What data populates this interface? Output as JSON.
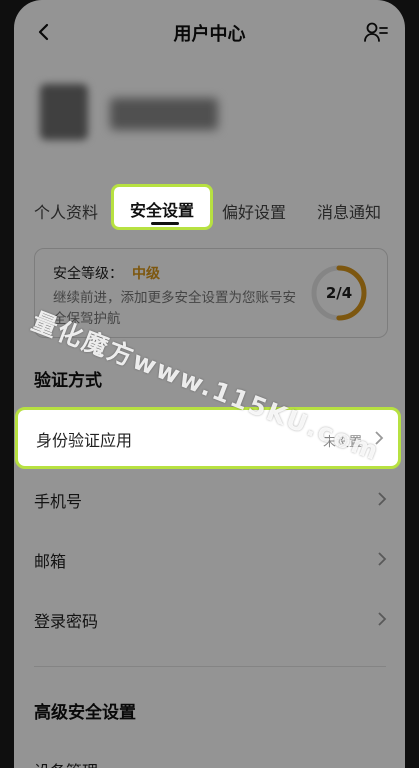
{
  "header": {
    "title": "用户中心"
  },
  "tabs": [
    "个人资料",
    "安全设置",
    "偏好设置",
    "消息通知"
  ],
  "security_card": {
    "level_label": "安全等级：",
    "level_value": "中级",
    "description": "继续前进，添加更多安全设置为您账号安全保驾护航",
    "progress_text": "2/4",
    "progress_fraction": 0.5
  },
  "verify_section": {
    "title": "验证方式",
    "items": [
      {
        "label": "身份验证应用",
        "status": "未设置"
      },
      {
        "label": "手机号",
        "status": ""
      },
      {
        "label": "邮箱",
        "status": ""
      },
      {
        "label": "登录密码",
        "status": ""
      }
    ]
  },
  "advanced_section": {
    "title": "高级安全设置",
    "items": [
      {
        "label": "设备管理"
      }
    ]
  },
  "watermark": "量化魔方www.115KU.com",
  "colors": {
    "highlight": "#b7e141",
    "level": "#d8961b"
  }
}
